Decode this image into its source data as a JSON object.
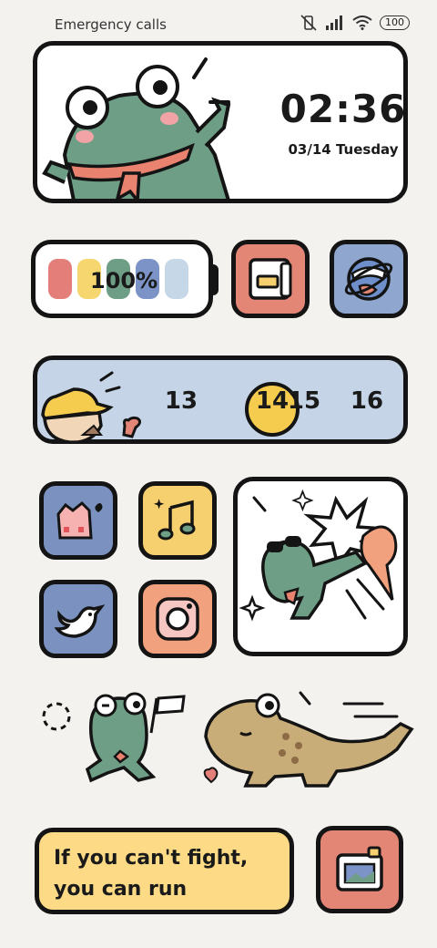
{
  "status_bar": {
    "carrier": "Emergency calls o",
    "battery": "100",
    "icons": [
      "vibrate-off-icon",
      "signal-icon",
      "wifi-icon",
      "battery-icon"
    ]
  },
  "clock_widget": {
    "time": "02:36",
    "date": "03/14 Tuesday"
  },
  "battery_widget": {
    "percent": "100%",
    "level": 1.0,
    "bar_colors": [
      "#e37f78",
      "#f6d66f",
      "#6f9e86",
      "#7b93c6",
      "#c6d7e8"
    ]
  },
  "apps_row1": [
    {
      "name": "file-manager-icon",
      "color": "#e38676"
    },
    {
      "name": "browser-icon",
      "color": "#8fa6cf"
    }
  ],
  "calendar_widget": {
    "days": [
      "13",
      "14",
      "15",
      "16"
    ],
    "selected": "14"
  },
  "apps_grid": [
    {
      "name": "gallery-icon",
      "color": "#7b91c0"
    },
    {
      "name": "music-icon",
      "color": "#f6d06f"
    },
    {
      "name": "bird-app-icon",
      "color": "#7b91c0"
    },
    {
      "name": "camera-app-icon",
      "color": "#f1a17d"
    }
  ],
  "quote_widget": {
    "line1": "If you can't fight,",
    "line2": "you can run"
  },
  "dock_app": {
    "name": "photos-icon",
    "color": "#e38676"
  },
  "colors": {
    "background": "#f4f2ee",
    "outline": "#141414",
    "frog_green": "#6f9e86",
    "highlight_yellow": "#f6cc4f",
    "calendar_blue": "#c5d4e6",
    "quote_yellow": "#fddb86"
  }
}
